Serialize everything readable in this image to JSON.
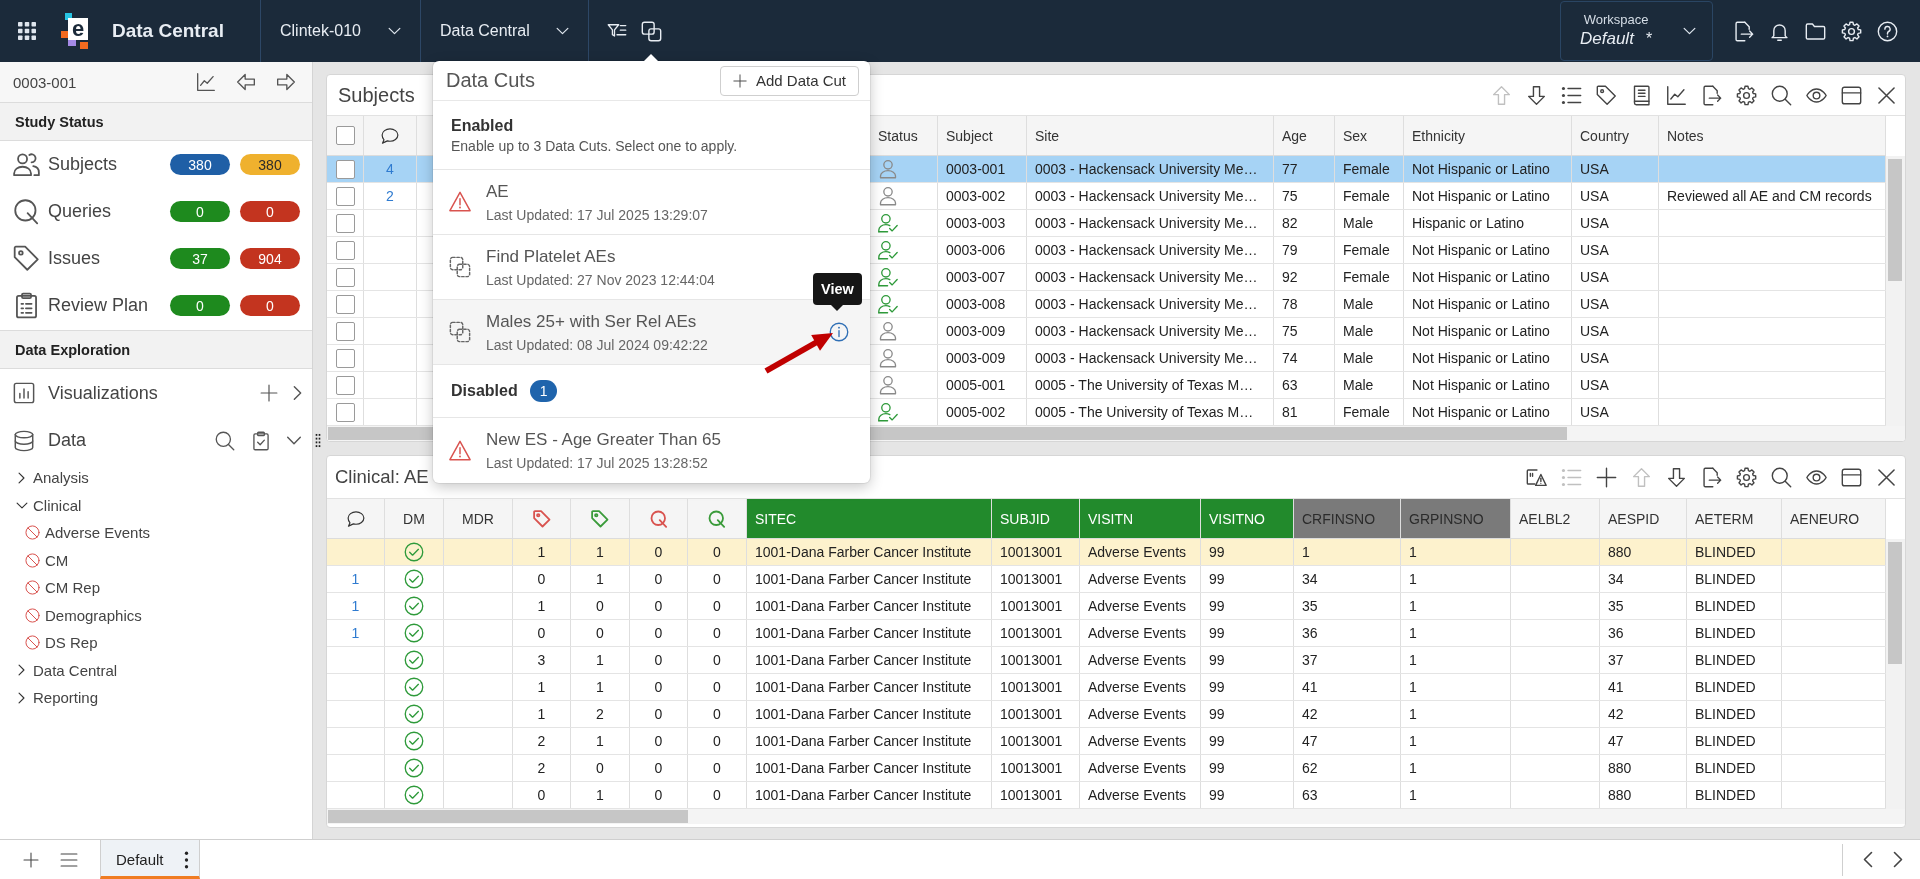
{
  "header": {
    "logo_letter": "e",
    "app_title": "Data Central",
    "selectors": [
      {
        "label": "Clintek-010"
      },
      {
        "label": "Data Central"
      }
    ],
    "workspace": {
      "label": "Workspace",
      "value": "Default",
      "unsaved_mark": "*"
    }
  },
  "sidebar": {
    "record": "0003-001",
    "study_status": {
      "title": "Study Status",
      "items": [
        {
          "label": "Subjects",
          "counts": [
            {
              "value": "380",
              "color": "#1f5fa6"
            },
            {
              "value": "380",
              "color": "#efb12e"
            }
          ]
        },
        {
          "label": "Queries",
          "counts": [
            {
              "value": "0",
              "color": "#1e8a1e"
            },
            {
              "value": "0",
              "color": "#c3341f"
            }
          ]
        },
        {
          "label": "Issues",
          "counts": [
            {
              "value": "37",
              "color": "#1e8a1e"
            },
            {
              "value": "904",
              "color": "#c3341f"
            }
          ]
        },
        {
          "label": "Review Plan",
          "counts": [
            {
              "value": "0",
              "color": "#1e8a1e"
            },
            {
              "value": "0",
              "color": "#c3341f"
            }
          ]
        }
      ]
    },
    "data_exploration": {
      "title": "Data Exploration",
      "items": [
        {
          "label": "Visualizations",
          "kind": "add",
          "expanded": false
        },
        {
          "label": "Data",
          "kind": "browse",
          "expanded": true
        }
      ],
      "tree": [
        {
          "label": "Analysis",
          "expanded": false
        },
        {
          "label": "Clinical",
          "expanded": true,
          "children": [
            {
              "label": "Adverse Events",
              "disabled": true
            },
            {
              "label": "CM",
              "disabled": true
            },
            {
              "label": "CM Rep",
              "disabled": true
            },
            {
              "label": "Demographics",
              "disabled": true
            },
            {
              "label": "DS Rep",
              "disabled": true
            }
          ]
        },
        {
          "label": "Data Central",
          "expanded": false
        },
        {
          "label": "Reporting",
          "expanded": false
        }
      ]
    }
  },
  "subjects_panel": {
    "title": "Subjects",
    "toolbar": [
      {
        "disabled": true
      },
      {
        "disabled": false
      },
      {
        "disabled": false
      },
      {
        "disabled": false
      },
      {
        "disabled": false
      },
      {
        "disabled": false
      },
      {
        "disabled": false
      },
      {
        "disabled": false
      },
      {
        "disabled": false
      },
      {
        "disabled": false
      },
      {
        "disabled": false
      },
      {
        "disabled": false
      }
    ],
    "table": {
      "columns": [
        {
          "kind": "checkbox",
          "checked": false
        },
        {
          "kind": "comment"
        },
        {
          "kind": "status",
          "label": "Status"
        },
        {
          "kind": "text",
          "label": "Subject"
        },
        {
          "kind": "text",
          "label": "Site"
        },
        {
          "kind": "text",
          "label": "Age"
        },
        {
          "kind": "text",
          "label": "Sex"
        },
        {
          "kind": "text",
          "label": "Ethnicity"
        },
        {
          "kind": "text",
          "label": "Country"
        },
        {
          "kind": "text",
          "label": "Notes"
        }
      ],
      "rows": [
        {
          "selected": true,
          "checked": false,
          "status_checked": false,
          "cells": [
            "",
            "4",
            "",
            "0003-001",
            "0003 - Hackensack University Me…",
            "77",
            "Female",
            "Not Hispanic or Latino",
            "USA"
          ]
        },
        {
          "selected": false,
          "checked": false,
          "status_checked": false,
          "cells": [
            "",
            "2",
            "",
            "0003-002",
            "0003 - Hackensack University Me…",
            "75",
            "Female",
            "Not Hispanic or Latino",
            "USA",
            "Reviewed all AE and CM records"
          ]
        },
        {
          "selected": false,
          "checked": false,
          "status_checked": true,
          "cells": [
            "",
            "",
            "",
            "0003-003",
            "0003 - Hackensack University Me…",
            "82",
            "Male",
            "Hispanic or Latino",
            "USA"
          ]
        },
        {
          "selected": false,
          "checked": false,
          "status_checked": true,
          "cells": [
            "",
            "",
            "",
            "0003-006",
            "0003 - Hackensack University Me…",
            "79",
            "Female",
            "Not Hispanic or Latino",
            "USA"
          ]
        },
        {
          "selected": false,
          "checked": false,
          "status_checked": true,
          "cells": [
            "",
            "",
            "",
            "0003-007",
            "0003 - Hackensack University Me…",
            "92",
            "Female",
            "Not Hispanic or Latino",
            "USA"
          ]
        },
        {
          "selected": false,
          "checked": false,
          "status_checked": true,
          "cells": [
            "",
            "",
            "",
            "0003-008",
            "0003 - Hackensack University Me…",
            "78",
            "Male",
            "Not Hispanic or Latino",
            "USA"
          ]
        },
        {
          "selected": false,
          "checked": false,
          "status_checked": false,
          "cells": [
            "",
            "",
            "",
            "0003-009",
            "0003 - Hackensack University Me…",
            "75",
            "Male",
            "Not Hispanic or Latino",
            "USA"
          ]
        },
        {
          "selected": false,
          "checked": false,
          "status_checked": false,
          "cells": [
            "",
            "",
            "",
            "0003-009",
            "0003 - Hackensack University Me…",
            "74",
            "Male",
            "Not Hispanic or Latino",
            "USA"
          ]
        },
        {
          "selected": false,
          "checked": false,
          "status_checked": false,
          "cells": [
            "",
            "",
            "",
            "0005-001",
            "0005 - The University of Texas M…",
            "63",
            "Male",
            "Not Hispanic or Latino",
            "USA"
          ]
        },
        {
          "selected": false,
          "checked": false,
          "status_checked": true,
          "cells": [
            "",
            "",
            "",
            "0005-002",
            "0005 - The University of Texas M…",
            "81",
            "Female",
            "Not Hispanic or Latino",
            "USA"
          ]
        }
      ]
    }
  },
  "data_cuts": {
    "title": "Data Cuts",
    "add_button": "Add Data Cut",
    "groups": [
      {
        "title": "Enabled",
        "note": "Enable up to 3 Data Cuts. Select one to apply.",
        "items": [
          {
            "name": "AE",
            "updated": "Last Updated: 17 Jul 2025 13:29:07",
            "kind": "warning",
            "hovered": false
          },
          {
            "name": "Find Platelet AEs",
            "updated": "Last Updated: 27 Nov 2023 12:44:04",
            "kind": "cut",
            "hovered": false
          },
          {
            "name": "Males 25+ with Ser Rel AEs",
            "updated": "Last Updated: 08 Jul 2024 09:42:22",
            "kind": "cut",
            "hovered": true,
            "tooltip": "View"
          }
        ]
      },
      {
        "title": "Disabled",
        "count": "1",
        "items": [
          {
            "name": "New ES - Age Greater Than 65",
            "updated": "Last Updated: 17 Jul 2025 13:28:52",
            "kind": "warning",
            "hovered": false
          }
        ]
      }
    ]
  },
  "clinical_panel": {
    "title": "Clinical: AE",
    "toolbar": [
      {
        "disabled": false
      },
      {
        "disabled": true
      },
      {
        "disabled": false
      },
      {
        "disabled": true
      },
      {
        "disabled": false
      },
      {
        "disabled": false
      },
      {
        "disabled": false
      },
      {
        "disabled": false
      },
      {
        "disabled": false
      },
      {
        "disabled": false
      },
      {
        "disabled": false
      }
    ],
    "table": {
      "columns": [
        {
          "kind": "comment"
        },
        {
          "kind": "check",
          "label": "DM"
        },
        {
          "kind": "text",
          "label": "MDR"
        },
        {
          "kind": "tag",
          "color": "#d9534f"
        },
        {
          "kind": "tag",
          "color": "#3a9b3a"
        },
        {
          "kind": "query",
          "color": "#d9534f"
        },
        {
          "kind": "query",
          "color": "#3a9b3a"
        },
        {
          "kind": "text",
          "label": "SITEC",
          "color": "#228a2c"
        },
        {
          "kind": "text",
          "label": "SUBJID",
          "color": "#228a2c"
        },
        {
          "kind": "text",
          "label": "VISITN",
          "color": "#228a2c"
        },
        {
          "kind": "text",
          "label": "VISITNO",
          "color": "#228a2c"
        },
        {
          "kind": "text",
          "label": "CRFINSNO",
          "color": "#7a7a7a"
        },
        {
          "kind": "text",
          "label": "GRPINSNO",
          "color": "#7a7a7a"
        },
        {
          "kind": "text",
          "label": "AELBL2"
        },
        {
          "kind": "text",
          "label": "AESPID"
        },
        {
          "kind": "text",
          "label": "AETERM"
        },
        {
          "kind": "text",
          "label": "AENEURO"
        }
      ],
      "rows": [
        {
          "selected": true,
          "dm_checked": true,
          "cells": [
            "",
            "",
            "",
            "1",
            "1",
            "0",
            "0",
            "1001-Dana Farber Cancer Institute",
            "10013001",
            "Adverse Events",
            "99",
            "1",
            "1",
            "",
            "880",
            "BLINDED"
          ]
        },
        {
          "selected": false,
          "dm_checked": true,
          "cells": [
            "1",
            "",
            "",
            "0",
            "1",
            "0",
            "0",
            "1001-Dana Farber Cancer Institute",
            "10013001",
            "Adverse Events",
            "99",
            "34",
            "1",
            "",
            "34",
            "BLINDED"
          ]
        },
        {
          "selected": false,
          "dm_checked": true,
          "cells": [
            "1",
            "",
            "",
            "1",
            "0",
            "0",
            "0",
            "1001-Dana Farber Cancer Institute",
            "10013001",
            "Adverse Events",
            "99",
            "35",
            "1",
            "",
            "35",
            "BLINDED"
          ]
        },
        {
          "selected": false,
          "dm_checked": true,
          "cells": [
            "1",
            "",
            "",
            "0",
            "0",
            "0",
            "0",
            "1001-Dana Farber Cancer Institute",
            "10013001",
            "Adverse Events",
            "99",
            "36",
            "1",
            "",
            "36",
            "BLINDED"
          ]
        },
        {
          "selected": false,
          "dm_checked": true,
          "cells": [
            "",
            "",
            "",
            "3",
            "1",
            "0",
            "0",
            "1001-Dana Farber Cancer Institute",
            "10013001",
            "Adverse Events",
            "99",
            "37",
            "1",
            "",
            "37",
            "BLINDED"
          ]
        },
        {
          "selected": false,
          "dm_checked": true,
          "cells": [
            "",
            "",
            "",
            "1",
            "1",
            "0",
            "0",
            "1001-Dana Farber Cancer Institute",
            "10013001",
            "Adverse Events",
            "99",
            "41",
            "1",
            "",
            "41",
            "BLINDED"
          ]
        },
        {
          "selected": false,
          "dm_checked": true,
          "cells": [
            "",
            "",
            "",
            "1",
            "2",
            "0",
            "0",
            "1001-Dana Farber Cancer Institute",
            "10013001",
            "Adverse Events",
            "99",
            "42",
            "1",
            "",
            "42",
            "BLINDED"
          ]
        },
        {
          "selected": false,
          "dm_checked": true,
          "cells": [
            "",
            "",
            "",
            "2",
            "1",
            "0",
            "0",
            "1001-Dana Farber Cancer Institute",
            "10013001",
            "Adverse Events",
            "99",
            "47",
            "1",
            "",
            "47",
            "BLINDED"
          ]
        },
        {
          "selected": false,
          "dm_checked": true,
          "cells": [
            "",
            "",
            "",
            "2",
            "0",
            "0",
            "0",
            "1001-Dana Farber Cancer Institute",
            "10013001",
            "Adverse Events",
            "99",
            "62",
            "1",
            "",
            "880",
            "BLINDED"
          ]
        },
        {
          "selected": false,
          "dm_checked": true,
          "cells": [
            "",
            "",
            "",
            "0",
            "1",
            "0",
            "0",
            "1001-Dana Farber Cancer Institute",
            "10013001",
            "Adverse Events",
            "99",
            "63",
            "1",
            "",
            "880",
            "BLINDED"
          ]
        }
      ]
    }
  },
  "bottom_bar": {
    "tabs": [
      {
        "label": "Default",
        "selected": true
      }
    ]
  }
}
